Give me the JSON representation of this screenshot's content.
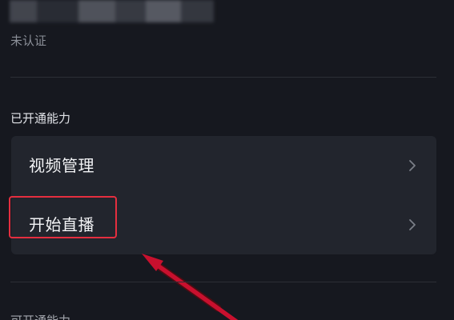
{
  "profile": {
    "account_name_blurred": "",
    "verification_status": "未认证"
  },
  "sections": {
    "enabled_title": "已开通能力",
    "available_title": "可开通能力"
  },
  "capabilities": [
    {
      "label": "视频管理",
      "icon": "chevron-right-icon"
    },
    {
      "label": "开始直播",
      "icon": "chevron-right-icon"
    }
  ],
  "annotation": {
    "highlight_color": "#e52e3f",
    "arrow_color": "#c8102e"
  },
  "colors": {
    "background": "#16181f",
    "card": "#22252d",
    "primary_text": "#f2f3f5",
    "secondary_text": "#8b8f98",
    "chevron": "#7b7f88"
  }
}
